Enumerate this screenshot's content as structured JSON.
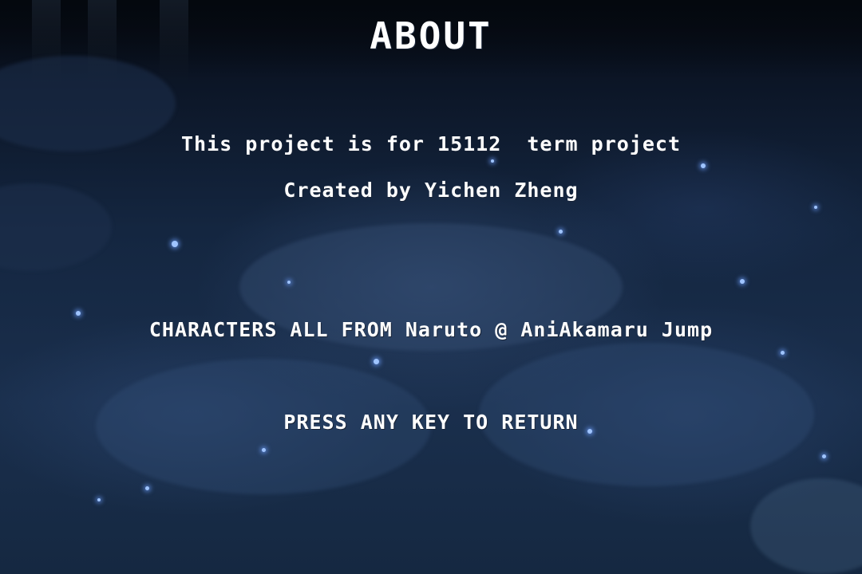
{
  "screen": {
    "title": "ABOUT",
    "project_line": "This project is for 15112  term project",
    "creator_line": "Created by Yichen Zheng",
    "credits_line": "CHARACTERS ALL FROM Naruto @ AniAkamaru Jump",
    "return_prompt": "PRESS ANY KEY TO RETURN"
  },
  "colors": {
    "text": "#ffffff",
    "sky_top": "#050a12",
    "sky_mid": "#142640",
    "star_glow": "#9fc4ff"
  }
}
